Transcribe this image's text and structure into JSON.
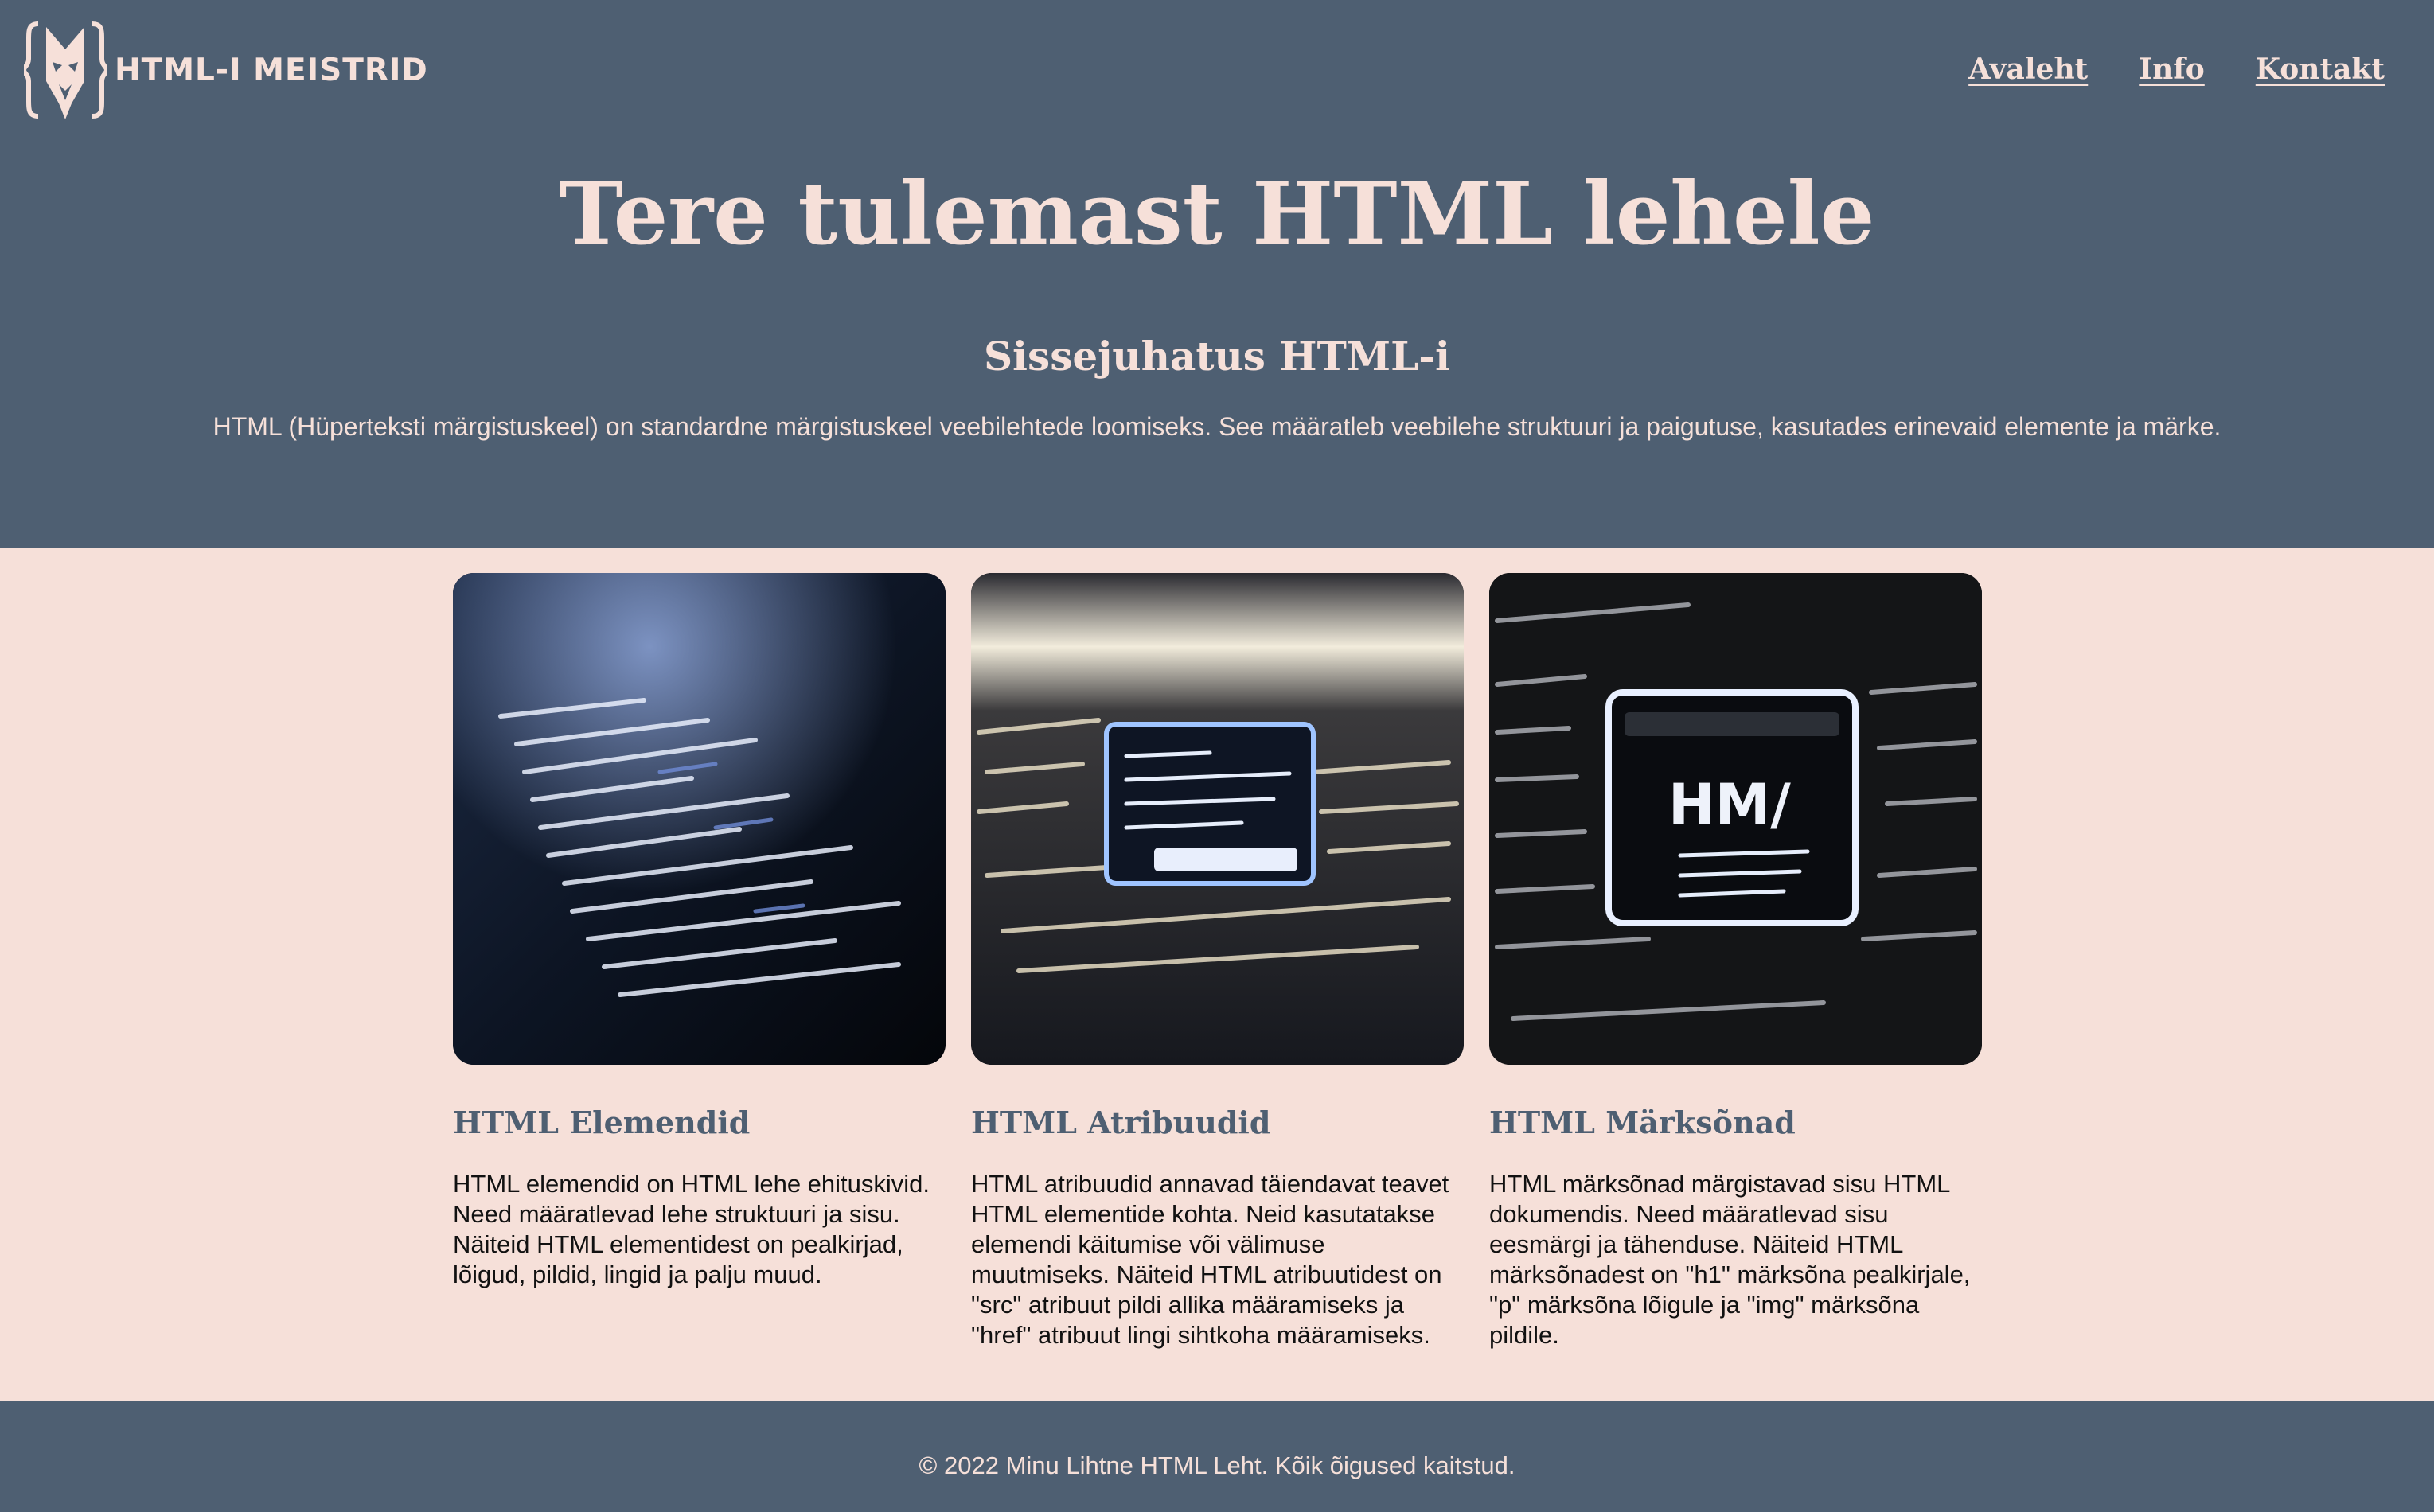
{
  "header": {
    "logo_text": "HTML-I MEISTRID",
    "nav": [
      {
        "label": "Avaleht"
      },
      {
        "label": "Info"
      },
      {
        "label": "Kontakt"
      }
    ]
  },
  "hero": {
    "title": "Tere tulemast HTML lehele"
  },
  "intro": {
    "title": "Sissejuhatus HTML-i",
    "text": "HTML (Hüperteksti märgistuskeel) on standardne märgistuskeel veebilehtede loomiseks. See määratleb veebilehe struktuuri ja paigutuse, kasutades erinevaid elemente ja märke."
  },
  "cards": [
    {
      "title": "HTML Elemendid",
      "text": "HTML elemendid on HTML lehe ehituskivid. Need määratlevad lehe struktuuri ja sisu. Näiteid HTML elementidest on pealkirjad, lõigud, pildid, lingid ja palju muud.",
      "image": "code-screen-image"
    },
    {
      "title": "HTML Atribuudid",
      "text": "HTML atribuudid annavad täiendavat teavet HTML elementide kohta. Neid kasutatakse elemendi käitumise või välimuse muutmiseks. Näiteid HTML atribuutidest on \"src\" atribuut pildi allika määramiseks ja \"href\" atribuut lingi sihtkoha määramiseks.",
      "image": "code-popup-image"
    },
    {
      "title": "HTML Märksõnad",
      "text": "HTML märksõnad märgistavad sisu HTML dokumendis. Need määratlevad sisu eesmärgi ja tähenduse. Näiteid HTML märksõnadest on \"h1\" märksõna pealkirjale, \"p\" märksõna lõigule ja \"img\" märksõna pildile.",
      "image": "code-window-image"
    }
  ],
  "footer": {
    "text": "© 2022 Minu Lihtne HTML Leht. Kõik õigused kaitstud."
  },
  "colors": {
    "header_bg": "#4e5f72",
    "page_bg": "#f6e0d9",
    "accent_text": "#f6e0d9",
    "card_title": "#4e5f72"
  }
}
